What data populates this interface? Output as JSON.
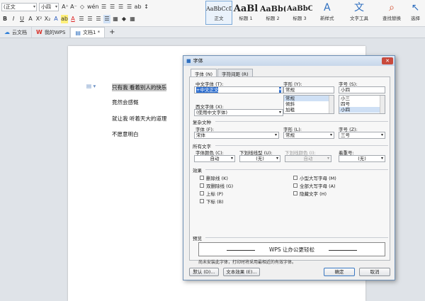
{
  "ribbon": {
    "style_box": "(正文",
    "size_box": "小四",
    "row1_tools": [
      "A⁺",
      "A⁻",
      "◇",
      "wén",
      "☰",
      "☰",
      "☰",
      "☰",
      "ab",
      "↕"
    ],
    "row2_tools": [
      "B",
      "I",
      "U",
      "A",
      "X²",
      "X₂",
      "A",
      "ab",
      "A",
      "☰",
      "☰",
      "☰",
      "☰",
      "▦",
      "◆",
      "▦"
    ],
    "styles": [
      {
        "preview": "AaBbCcDd",
        "name": "正文"
      },
      {
        "preview": "AaBl",
        "name": "标题 1"
      },
      {
        "preview": "AaBb(",
        "name": "标题 2"
      },
      {
        "preview": "AaBbC",
        "name": "标题 3"
      }
    ],
    "tools": [
      {
        "icon": "A",
        "label": "新样式"
      },
      {
        "icon": "文",
        "label": "文字工具"
      },
      {
        "icon": "⌕",
        "label": "查找替换"
      },
      {
        "icon": "↖",
        "label": "选择"
      }
    ]
  },
  "tabs": [
    {
      "icon": "☁",
      "label": "云文档"
    },
    {
      "icon": "W",
      "label": "我的WPS"
    },
    {
      "icon": "▤",
      "label": "文档1 *"
    }
  ],
  "tab_add": "+",
  "document": {
    "lines": [
      "只有我 看着别人的快乐",
      "竟然会感慨",
      "就让我 听着天大的道理",
      "不愿意明白"
    ]
  },
  "dialog": {
    "title": "字体",
    "close": "✕",
    "tabs": [
      "字体 (N)",
      "字符间距 (R)"
    ],
    "cn_font_label": "中文字体 (T):",
    "cn_font_value": "+中文正文",
    "style_label": "字形 (Y):",
    "style_value": "常规",
    "style_list": [
      "常规",
      "倾斜",
      "加粗"
    ],
    "size_label": "字号 (S):",
    "size_value": "小四",
    "size_list": [
      "小三",
      "四号",
      "小四"
    ],
    "west_font_label": "西文字体 (X):",
    "west_font_value": "(使用中文字体)",
    "complex_group": "复杂文种",
    "complex_font_label": "字体 (F):",
    "complex_font_value": "宋体",
    "complex_style_label": "字形 (L):",
    "complex_style_value": "常规",
    "complex_size_label": "字号 (Z):",
    "complex_size_value": "三号",
    "all_text_group": "所有文字",
    "color_label": "字体颜色 (C):",
    "color_value": "自动",
    "underline_label": "下划线线型 (U):",
    "underline_value": "(无)",
    "underline_color_label": "下划线颜色 (I):",
    "underline_color_value": "自动",
    "emphasis_label": "着重号:",
    "emphasis_value": "(无)",
    "effects_group": "效果",
    "effects_left": [
      "删除线 (K)",
      "双删除线 (G)",
      "上标 (P)",
      "下标 (B)"
    ],
    "effects_right": [
      "小型大写字母 (M)",
      "全部大写字母 (A)",
      "隐藏文字 (H)"
    ],
    "preview_group": "预览",
    "preview_text": "WPS 让办公更轻松",
    "preview_note": "尚未安装此字体，打印时将采用最相近的有效字体。",
    "btn_default": "默认 (D)...",
    "btn_effects": "文本效果 (E)...",
    "btn_ok": "确定",
    "btn_cancel": "取消"
  }
}
